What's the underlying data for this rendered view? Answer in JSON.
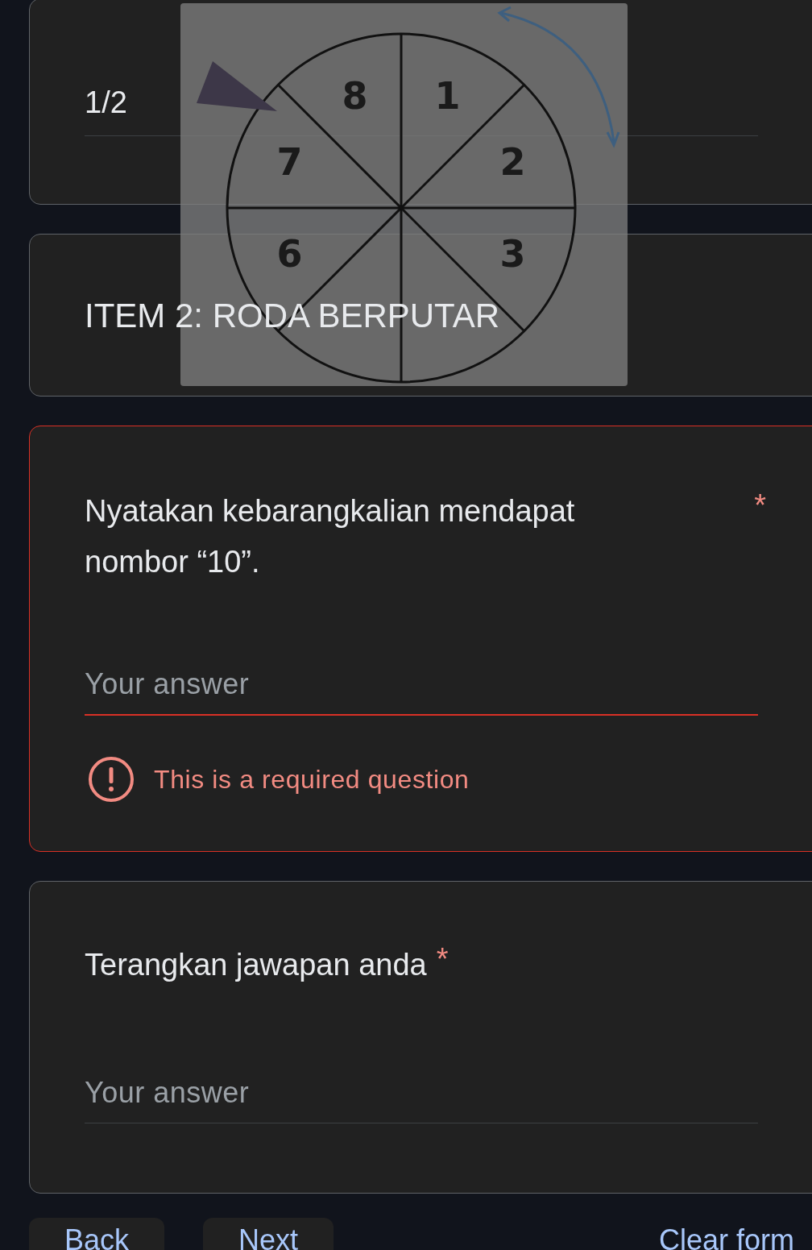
{
  "cards": [
    {
      "kind": "answer",
      "value": "1/2"
    },
    {
      "kind": "section",
      "title": "ITEM 2: RODA BERPUTAR"
    },
    {
      "kind": "question",
      "title": "Nyatakan kebarangkalian mendapat nombor “10”.",
      "required_mark": "*",
      "placeholder": "Your answer",
      "error": "This is a required question"
    },
    {
      "kind": "question",
      "title": "Terangkan jawapan anda",
      "required_mark": "*",
      "placeholder": "Your answer"
    }
  ],
  "image_overlay": {
    "wheel_labels": [
      "6",
      "7",
      "8",
      "1",
      "2",
      "3"
    ]
  },
  "buttons": [
    {
      "label": "Back",
      "kind": "filled"
    },
    {
      "label": "Next",
      "kind": "filled"
    },
    {
      "label": "Clear form",
      "kind": "text"
    }
  ]
}
